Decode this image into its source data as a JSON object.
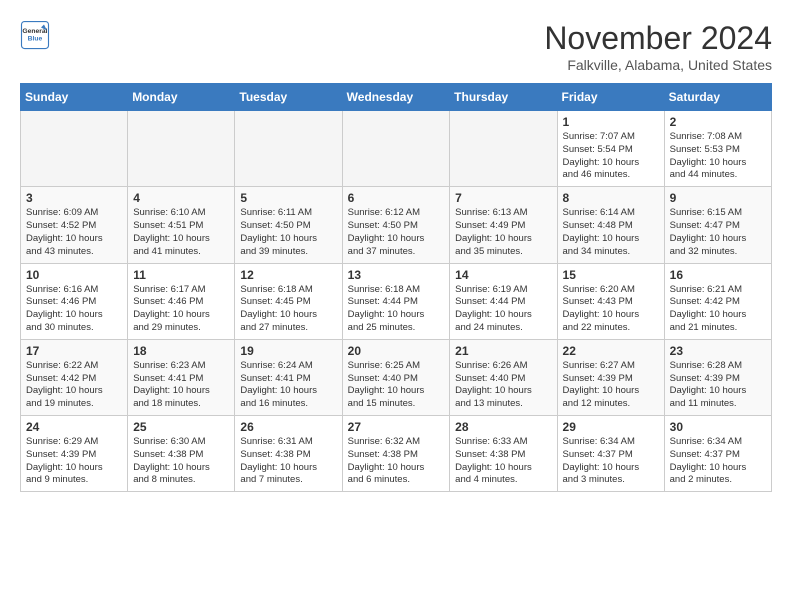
{
  "header": {
    "logo_line1": "General",
    "logo_line2": "Blue",
    "month": "November 2024",
    "location": "Falkville, Alabama, United States"
  },
  "weekdays": [
    "Sunday",
    "Monday",
    "Tuesday",
    "Wednesday",
    "Thursday",
    "Friday",
    "Saturday"
  ],
  "weeks": [
    [
      {
        "day": "",
        "info": ""
      },
      {
        "day": "",
        "info": ""
      },
      {
        "day": "",
        "info": ""
      },
      {
        "day": "",
        "info": ""
      },
      {
        "day": "",
        "info": ""
      },
      {
        "day": "1",
        "info": "Sunrise: 7:07 AM\nSunset: 5:54 PM\nDaylight: 10 hours\nand 46 minutes."
      },
      {
        "day": "2",
        "info": "Sunrise: 7:08 AM\nSunset: 5:53 PM\nDaylight: 10 hours\nand 44 minutes."
      }
    ],
    [
      {
        "day": "3",
        "info": "Sunrise: 6:09 AM\nSunset: 4:52 PM\nDaylight: 10 hours\nand 43 minutes."
      },
      {
        "day": "4",
        "info": "Sunrise: 6:10 AM\nSunset: 4:51 PM\nDaylight: 10 hours\nand 41 minutes."
      },
      {
        "day": "5",
        "info": "Sunrise: 6:11 AM\nSunset: 4:50 PM\nDaylight: 10 hours\nand 39 minutes."
      },
      {
        "day": "6",
        "info": "Sunrise: 6:12 AM\nSunset: 4:50 PM\nDaylight: 10 hours\nand 37 minutes."
      },
      {
        "day": "7",
        "info": "Sunrise: 6:13 AM\nSunset: 4:49 PM\nDaylight: 10 hours\nand 35 minutes."
      },
      {
        "day": "8",
        "info": "Sunrise: 6:14 AM\nSunset: 4:48 PM\nDaylight: 10 hours\nand 34 minutes."
      },
      {
        "day": "9",
        "info": "Sunrise: 6:15 AM\nSunset: 4:47 PM\nDaylight: 10 hours\nand 32 minutes."
      }
    ],
    [
      {
        "day": "10",
        "info": "Sunrise: 6:16 AM\nSunset: 4:46 PM\nDaylight: 10 hours\nand 30 minutes."
      },
      {
        "day": "11",
        "info": "Sunrise: 6:17 AM\nSunset: 4:46 PM\nDaylight: 10 hours\nand 29 minutes."
      },
      {
        "day": "12",
        "info": "Sunrise: 6:18 AM\nSunset: 4:45 PM\nDaylight: 10 hours\nand 27 minutes."
      },
      {
        "day": "13",
        "info": "Sunrise: 6:18 AM\nSunset: 4:44 PM\nDaylight: 10 hours\nand 25 minutes."
      },
      {
        "day": "14",
        "info": "Sunrise: 6:19 AM\nSunset: 4:44 PM\nDaylight: 10 hours\nand 24 minutes."
      },
      {
        "day": "15",
        "info": "Sunrise: 6:20 AM\nSunset: 4:43 PM\nDaylight: 10 hours\nand 22 minutes."
      },
      {
        "day": "16",
        "info": "Sunrise: 6:21 AM\nSunset: 4:42 PM\nDaylight: 10 hours\nand 21 minutes."
      }
    ],
    [
      {
        "day": "17",
        "info": "Sunrise: 6:22 AM\nSunset: 4:42 PM\nDaylight: 10 hours\nand 19 minutes."
      },
      {
        "day": "18",
        "info": "Sunrise: 6:23 AM\nSunset: 4:41 PM\nDaylight: 10 hours\nand 18 minutes."
      },
      {
        "day": "19",
        "info": "Sunrise: 6:24 AM\nSunset: 4:41 PM\nDaylight: 10 hours\nand 16 minutes."
      },
      {
        "day": "20",
        "info": "Sunrise: 6:25 AM\nSunset: 4:40 PM\nDaylight: 10 hours\nand 15 minutes."
      },
      {
        "day": "21",
        "info": "Sunrise: 6:26 AM\nSunset: 4:40 PM\nDaylight: 10 hours\nand 13 minutes."
      },
      {
        "day": "22",
        "info": "Sunrise: 6:27 AM\nSunset: 4:39 PM\nDaylight: 10 hours\nand 12 minutes."
      },
      {
        "day": "23",
        "info": "Sunrise: 6:28 AM\nSunset: 4:39 PM\nDaylight: 10 hours\nand 11 minutes."
      }
    ],
    [
      {
        "day": "24",
        "info": "Sunrise: 6:29 AM\nSunset: 4:39 PM\nDaylight: 10 hours\nand 9 minutes."
      },
      {
        "day": "25",
        "info": "Sunrise: 6:30 AM\nSunset: 4:38 PM\nDaylight: 10 hours\nand 8 minutes."
      },
      {
        "day": "26",
        "info": "Sunrise: 6:31 AM\nSunset: 4:38 PM\nDaylight: 10 hours\nand 7 minutes."
      },
      {
        "day": "27",
        "info": "Sunrise: 6:32 AM\nSunset: 4:38 PM\nDaylight: 10 hours\nand 6 minutes."
      },
      {
        "day": "28",
        "info": "Sunrise: 6:33 AM\nSunset: 4:38 PM\nDaylight: 10 hours\nand 4 minutes."
      },
      {
        "day": "29",
        "info": "Sunrise: 6:34 AM\nSunset: 4:37 PM\nDaylight: 10 hours\nand 3 minutes."
      },
      {
        "day": "30",
        "info": "Sunrise: 6:34 AM\nSunset: 4:37 PM\nDaylight: 10 hours\nand 2 minutes."
      }
    ]
  ]
}
